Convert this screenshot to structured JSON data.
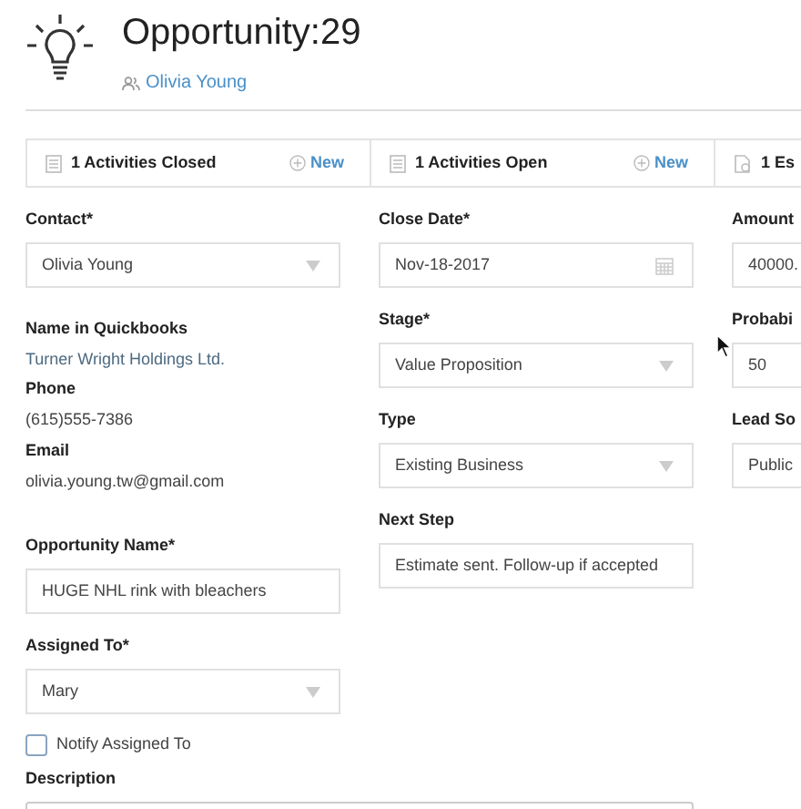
{
  "header": {
    "title": "Opportunity:29",
    "owner": "Olivia Young"
  },
  "tabs": [
    {
      "label": "1 Activities Closed",
      "action": "New"
    },
    {
      "label": "1 Activities Open",
      "action": "New"
    },
    {
      "label": "1 Es"
    }
  ],
  "columns": [
    [
      {
        "kind": "select",
        "label": "Contact*",
        "value": "Olivia Young"
      },
      {
        "kind": "info",
        "items": [
          {
            "label": "Name in Quickbooks",
            "value": "Turner Wright Holdings Ltd.",
            "linked": true
          },
          {
            "label": "Phone",
            "value": "(615)555-7386",
            "linked": false
          },
          {
            "label": "Email",
            "value": "olivia.young.tw@gmail.com",
            "linked": false
          }
        ]
      },
      {
        "kind": "text",
        "label": "Opportunity Name*",
        "value": "HUGE NHL rink with bleachers"
      },
      {
        "kind": "select",
        "label": "Assigned To*",
        "value": "Mary"
      },
      {
        "kind": "checkbox",
        "label": "Notify Assigned To",
        "checked": false
      },
      {
        "kind": "textarea",
        "label": "Description"
      }
    ],
    [
      {
        "kind": "date",
        "label": "Close Date*",
        "value": "Nov-18-2017"
      },
      {
        "kind": "select",
        "label": "Stage*",
        "value": "Value Proposition"
      },
      {
        "kind": "select",
        "label": "Type",
        "value": "Existing Business"
      },
      {
        "kind": "text",
        "label": "Next Step",
        "value": "Estimate sent. Follow-up if accepted"
      }
    ],
    [
      {
        "kind": "text",
        "label": "Amount",
        "value": "40000."
      },
      {
        "kind": "text",
        "label": "Probabi",
        "value": "50"
      },
      {
        "kind": "text",
        "label": "Lead So",
        "value": "Public"
      }
    ]
  ]
}
